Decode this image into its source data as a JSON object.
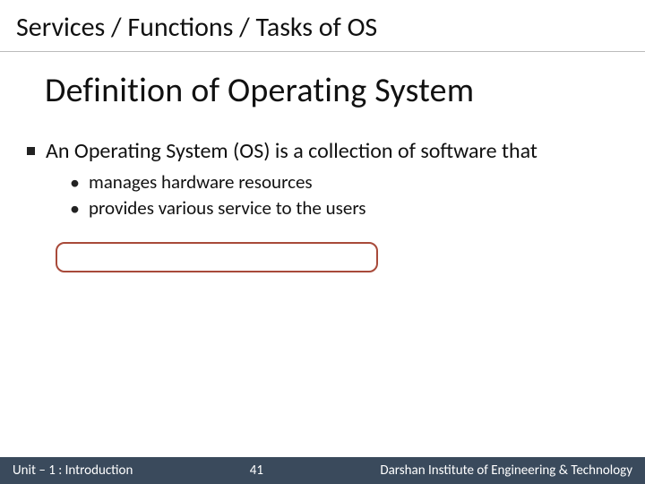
{
  "header": {
    "title": "Services / Functions / Tasks of OS"
  },
  "content": {
    "title": "Definition of Operating System",
    "main_bullet": "An Operating System (OS) is a collection of software that",
    "sub_bullets": {
      "0": "manages hardware resources",
      "1": "provides various service to the users"
    }
  },
  "footer": {
    "left": "Unit – 1 : Introduction",
    "page": "41",
    "right": "Darshan Institute of Engineering & Technology"
  }
}
